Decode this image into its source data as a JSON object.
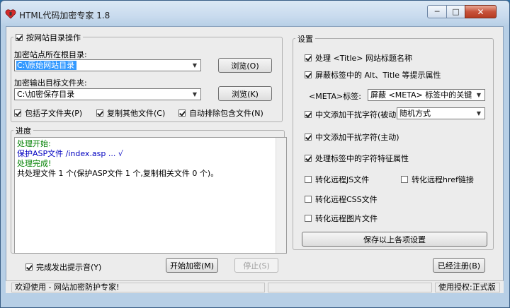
{
  "window": {
    "title": "HTML代码加密专家 1.8",
    "icon": "red-heart-icon",
    "controls": {
      "minimize": "─",
      "maximize": "□",
      "close": "✕"
    }
  },
  "left": {
    "group_label": "按网站目录操作",
    "group_checked": true,
    "root_label": "加密站点所在根目录:",
    "root_value": "C:\\原始网站目录",
    "output_label": "加密输出目标文件夹:",
    "output_value": "C:\\加密保存目录",
    "browse1": "浏览(O)",
    "browse2": "浏览(K)",
    "options": [
      {
        "label": "包括子文件夹(P)",
        "checked": true
      },
      {
        "label": "复制其他文件(C)",
        "checked": true
      },
      {
        "label": "自动排除包含文件(N)",
        "checked": true
      }
    ]
  },
  "progress": {
    "label": "进度",
    "lines": [
      {
        "text": "处理开始:",
        "color": "#008000"
      },
      {
        "text": "保护ASP文件  /index.asp ... √",
        "color": "#0000c0"
      },
      {
        "text": "处理完成!",
        "color": "#008000"
      },
      {
        "text": "共处理文件 1 个(保护ASP文件 1 个,复制相关文件 0 个)。",
        "color": "#000000"
      }
    ]
  },
  "settings": {
    "label": "设置",
    "items": [
      {
        "label": "处理 <Title> 网站标题名称",
        "checked": true
      },
      {
        "label": "屏蔽标签中的 Alt、Title 等提示属性",
        "checked": true
      }
    ],
    "meta_label": "<META>标签:",
    "meta_value": "屏蔽 <META> 标签中的关键字和描述",
    "chinese_passive": {
      "label": "中文添加干扰字符(被动)",
      "checked": true
    },
    "random_mode": "随机方式",
    "chinese_active": {
      "label": "中文添加干扰字符(主动)",
      "checked": true
    },
    "char_feature": {
      "label": "处理标签中的字符特征属性",
      "checked": true
    },
    "convert_js": {
      "label": "转化远程JS文件",
      "checked": false
    },
    "convert_href": {
      "label": "转化远程href链接",
      "checked": false
    },
    "convert_css": {
      "label": "转化远程CSS文件",
      "checked": false
    },
    "convert_img": {
      "label": "转化远程图片文件",
      "checked": false
    },
    "save_button": "保存以上各项设置"
  },
  "bottom": {
    "beep_label": "完成发出提示音(Y)",
    "beep_checked": true,
    "start_button": "开始加密(M)",
    "stop_button": "停止(S)",
    "registered_button": "已经注册(B)"
  },
  "status": {
    "welcome": "欢迎使用 - 网站加密防护专家!",
    "license": "使用授权:正式版"
  }
}
